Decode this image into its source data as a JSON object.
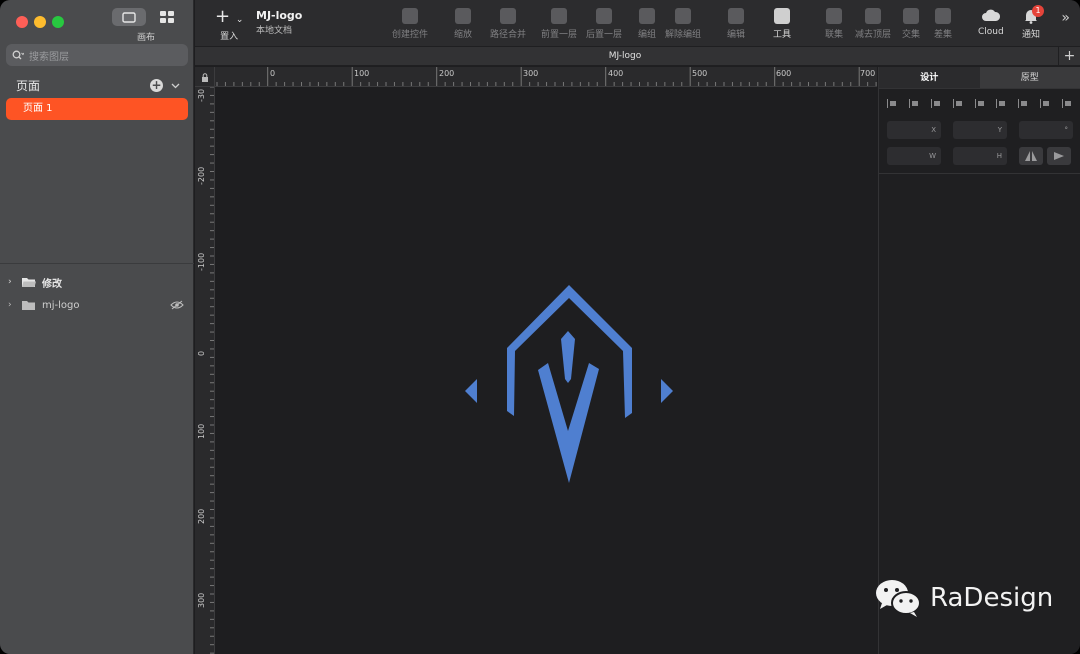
{
  "sidebar": {
    "view_label": "画布",
    "search_placeholder": "搜索图层",
    "pages_heading": "页面",
    "active_page": "页面 1",
    "layers": [
      {
        "label": "修改"
      },
      {
        "label": "mj-logo"
      }
    ]
  },
  "toolbar": {
    "insert_label": "置入",
    "doc_title": "MJ-logo",
    "doc_subtitle": "本地文档",
    "tools": [
      {
        "label": "创建控件",
        "icon": "component-icon"
      },
      {
        "label": "缩放",
        "icon": "scale-icon"
      },
      {
        "label": "路径合并",
        "icon": "path-join-icon"
      },
      {
        "label": "前置一层",
        "icon": "bring-forward-icon"
      },
      {
        "label": "后置一层",
        "icon": "send-backward-icon"
      },
      {
        "label": "编组",
        "icon": "group-icon"
      },
      {
        "label": "解除编组",
        "icon": "ungroup-icon"
      },
      {
        "label": "编辑",
        "icon": "edit-icon"
      },
      {
        "label": "工具",
        "icon": "tools-icon"
      },
      {
        "label": "联集",
        "icon": "union-icon"
      },
      {
        "label": "减去顶层",
        "icon": "subtract-icon"
      },
      {
        "label": "交集",
        "icon": "intersect-icon"
      },
      {
        "label": "差集",
        "icon": "difference-icon"
      },
      {
        "label": "Cloud",
        "icon": "cloud-icon"
      },
      {
        "label": "通知",
        "icon": "bell-icon"
      }
    ],
    "notification_count": "1"
  },
  "tab": {
    "title": "MJ-logo"
  },
  "rulers": {
    "top": [
      "0",
      "100",
      "200",
      "300",
      "400",
      "500",
      "600",
      "700"
    ],
    "left": [
      "-30",
      "-200",
      "-100",
      "0",
      "100",
      "200",
      "300"
    ]
  },
  "inspector": {
    "tab_design": "设计",
    "tab_prototype": "原型",
    "field_x": "X",
    "field_y": "Y",
    "field_rotation": "°",
    "field_w": "W",
    "field_h": "H"
  },
  "watermark": {
    "text": "RaDesign"
  },
  "colors": {
    "accent": "#fe5424",
    "logo": "#4f7fd0"
  }
}
